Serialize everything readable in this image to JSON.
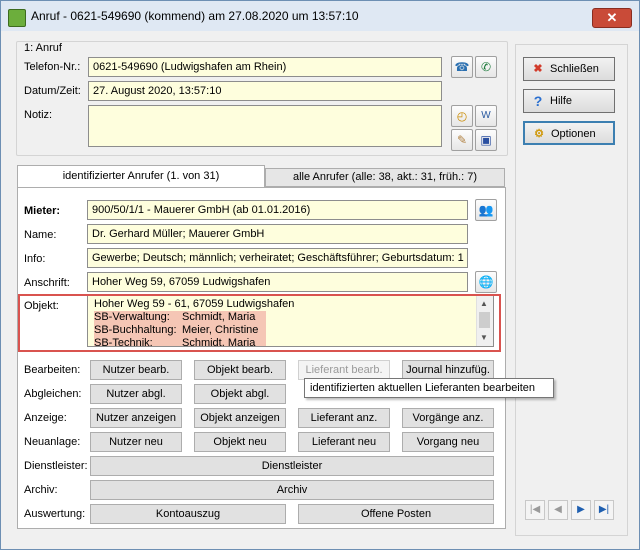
{
  "window": {
    "title": "Anruf - 0621-549690 (kommend) am 27.08.2020 um 13:57:10",
    "close": "✕"
  },
  "anruf": {
    "group_label": "1: Anruf",
    "telefon_label": "Telefon-Nr.:",
    "telefon_value": "0621-549690  (Ludwigshafen am Rhein)",
    "datum_label": "Datum/Zeit:",
    "datum_value": "27. August 2020,  13:57:10",
    "notiz_label": "Notiz:",
    "notiz_value": ""
  },
  "sidebar": {
    "close_label": "Schließen",
    "help_label": "Hilfe",
    "options_label": "Optionen"
  },
  "tabs": [
    {
      "label": "identifizierter Anrufer  (1. von 31)"
    },
    {
      "label": "alle Anrufer (alle: 38,  akt.: 31,  früh.: 7)"
    }
  ],
  "caller": {
    "mieter_label": "Mieter:",
    "mieter_value": "900/50/1/1 - Mauerer GmbH  (ab 01.01.2016)",
    "name_label": "Name:",
    "name_value": "Dr. Gerhard Müller;  Mauerer GmbH",
    "info_label": "Info:",
    "info_value": "Gewerbe;  Deutsch;  männlich;  verheiratet;  Geschäftsführer;  Geburtsdatum: 1",
    "anschrift_label": "Anschrift:",
    "anschrift_value": "Hoher Weg 59, 67059 Ludwigshafen",
    "objekt_label": "Objekt:",
    "objekt_address": "Hoher Weg 59 - 61, 67059 Ludwigshafen",
    "objekt_rows": [
      {
        "role": "SB-Verwaltung:",
        "person": "Schmidt, Maria"
      },
      {
        "role": "SB-Buchhaltung:",
        "person": "Meier, Christine"
      },
      {
        "role": "SB-Technik:",
        "person": "Schmidt, Maria"
      }
    ]
  },
  "actions": {
    "bearbeiten_label": "Bearbeiten:",
    "nutzer_bearb": "Nutzer bearb.",
    "objekt_bearb": "Objekt bearb.",
    "lieferant_bearb": "Lieferant bearb.",
    "journal": "Journal hinzufüg.",
    "abgleichen_label": "Abgleichen:",
    "nutzer_abgl": "Nutzer abgl.",
    "objekt_abgl": "Objekt abgl.",
    "anzeige_label": "Anzeige:",
    "nutzer_anz": "Nutzer anzeigen",
    "objekt_anz": "Objekt anzeigen",
    "lieferant_anz": "Lieferant anz.",
    "vorgaenge_anz": "Vorgänge anz.",
    "neuanlage_label": "Neuanlage:",
    "nutzer_neu": "Nutzer neu",
    "objekt_neu": "Objekt neu",
    "lieferant_neu": "Lieferant neu",
    "vorgang_neu": "Vorgang neu",
    "dienstleister_label": "Dienstleister:",
    "dienstleister": "Dienstleister",
    "archiv_label": "Archiv:",
    "archiv": "Archiv",
    "auswertung_label": "Auswertung:",
    "kontoauszug": "Kontoauszug",
    "offene_posten": "Offene Posten"
  },
  "tooltip": "identifizierten aktuellen Lieferanten bearbeiten",
  "nav": {
    "first": "|◀",
    "prev": "◀",
    "next": "▶",
    "last": "▶|"
  }
}
